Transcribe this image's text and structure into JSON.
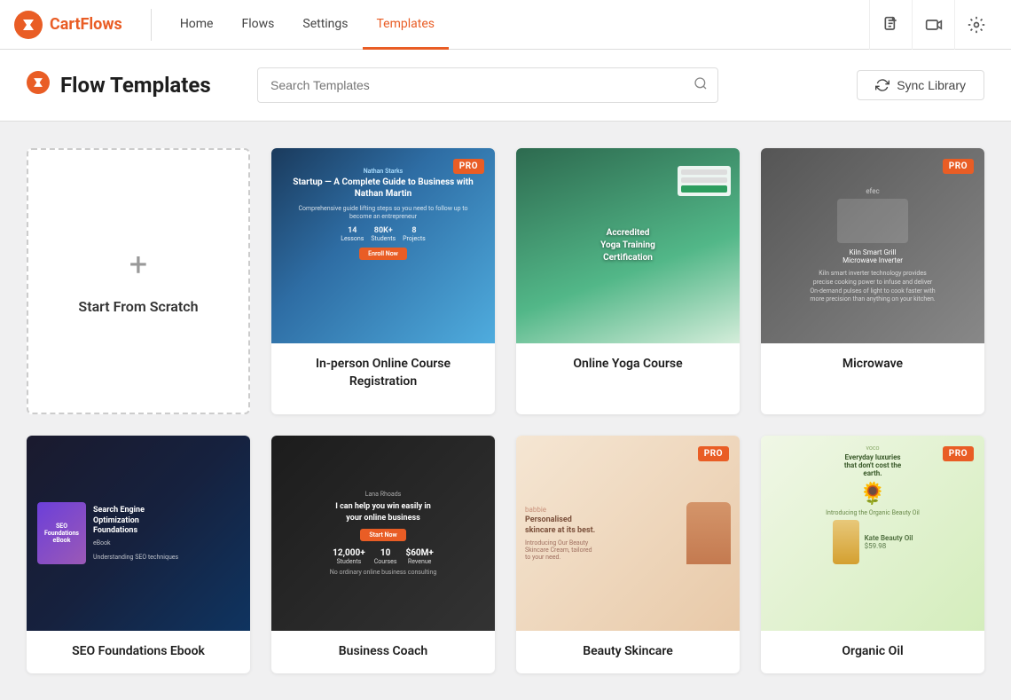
{
  "brand": {
    "name": "CartFlows",
    "logo_color": "#e95d25"
  },
  "nav": {
    "links": [
      {
        "label": "Home",
        "active": false
      },
      {
        "label": "Flows",
        "active": false
      },
      {
        "label": "Settings",
        "active": false
      },
      {
        "label": "Templates",
        "active": true
      }
    ],
    "icons": [
      "document-icon",
      "video-icon",
      "settings-icon"
    ]
  },
  "header": {
    "title": "Flow Templates",
    "search_placeholder": "Search Templates",
    "sync_label": "Sync Library"
  },
  "templates": {
    "scratch_label": "Start From Scratch",
    "cards": [
      {
        "name": "In-person Online Course Registration",
        "pro": true,
        "thumb_type": "course1"
      },
      {
        "name": "Online Yoga Course",
        "pro": false,
        "thumb_type": "yoga"
      },
      {
        "name": "Microwave",
        "pro": true,
        "thumb_type": "micro"
      },
      {
        "name": "SEO Foundations Ebook",
        "pro": false,
        "thumb_type": "seo"
      },
      {
        "name": "Business Coach",
        "pro": false,
        "thumb_type": "biz"
      },
      {
        "name": "Beauty Skincare",
        "pro": true,
        "thumb_type": "skin"
      },
      {
        "name": "Organic Oil",
        "pro": true,
        "thumb_type": "organic"
      }
    ]
  }
}
